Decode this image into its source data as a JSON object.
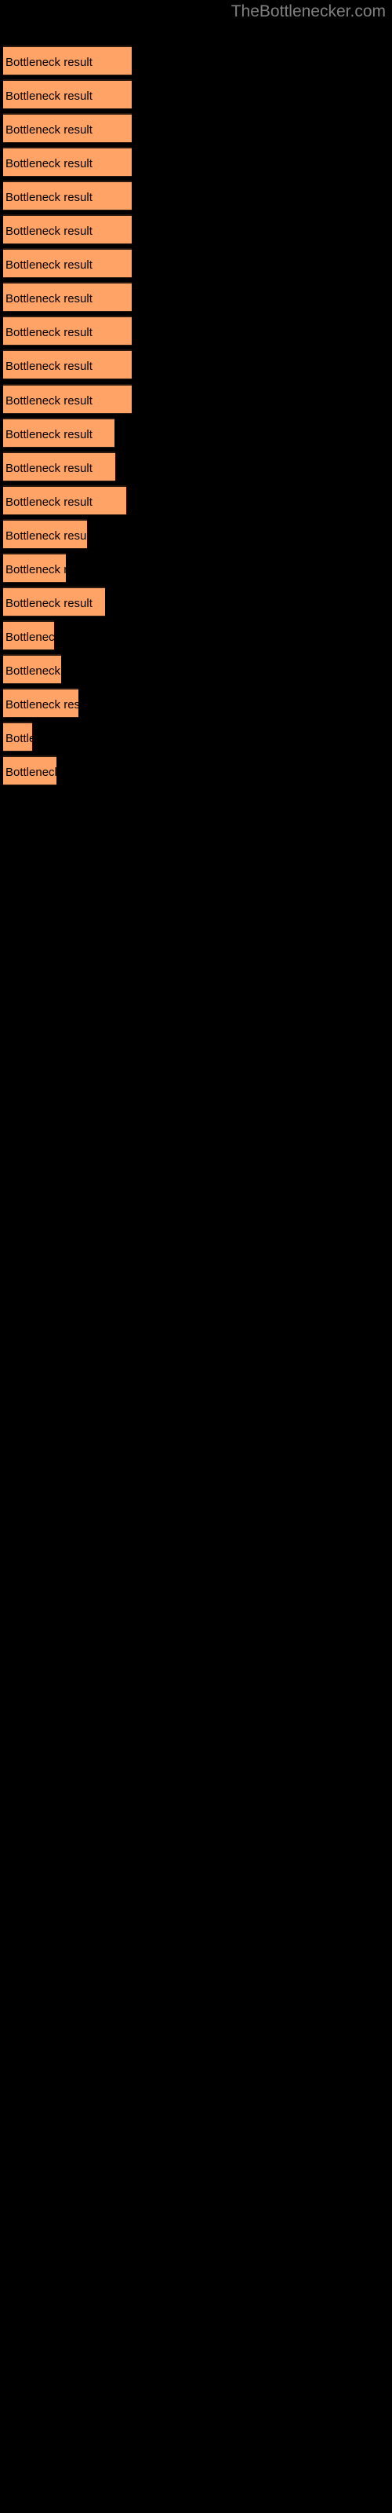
{
  "site": {
    "title": "TheBottlenecker.com",
    "title_color": "#808080"
  },
  "theme": {
    "background": "#000000",
    "bar_fill": "#FFA366",
    "bar_border": "#2b1a0f",
    "label_color": "#000000"
  },
  "chart_data": {
    "type": "bar",
    "orientation": "horizontal",
    "title": "",
    "subtitle": "",
    "xlabel": "",
    "ylabel": "",
    "grid": false,
    "legend": null,
    "axis_visible": false,
    "tick_labels": [],
    "bar_label_text": "Bottleneck result",
    "xlim": [
      0,
      500
    ],
    "categories": [
      "Bottleneck result",
      "Bottleneck result",
      "Bottleneck result",
      "Bottleneck result",
      "Bottleneck result",
      "Bottleneck result",
      "Bottleneck result",
      "Bottleneck result",
      "Bottleneck result",
      "Bottleneck result",
      "Bottleneck result",
      "Bottleneck result",
      "Bottleneck result",
      "Bottleneck result",
      "Bottleneck result",
      "Bottleneck result",
      "Bottleneck result",
      "Bottleneck result",
      "Bottleneck result",
      "Bottleneck result",
      "Bottleneck result",
      "Bottleneck result"
    ],
    "values": [
      164,
      164,
      164,
      164,
      164,
      164,
      164,
      164,
      164,
      164,
      164,
      142,
      143,
      157,
      107,
      80,
      130,
      65,
      74,
      96,
      37,
      68
    ],
    "bars": [
      {
        "index": 1,
        "label": "Bottleneck result",
        "y": 58,
        "width": 164,
        "value": 164
      },
      {
        "index": 2,
        "label": "Bottleneck result",
        "y": 101,
        "width": 164,
        "value": 164
      },
      {
        "index": 3,
        "label": "Bottleneck result",
        "y": 144,
        "width": 164,
        "value": 164
      },
      {
        "index": 4,
        "label": "Bottleneck result",
        "y": 187,
        "width": 164,
        "value": 164
      },
      {
        "index": 5,
        "label": "Bottleneck result",
        "y": 230,
        "width": 164,
        "value": 164
      },
      {
        "index": 6,
        "label": "Bottleneck result",
        "y": 273,
        "width": 164,
        "value": 164
      },
      {
        "index": 7,
        "label": "Bottleneck result",
        "y": 316,
        "width": 164,
        "value": 164
      },
      {
        "index": 8,
        "label": "Bottleneck result",
        "y": 359,
        "width": 164,
        "value": 164
      },
      {
        "index": 9,
        "label": "Bottleneck result",
        "y": 402,
        "width": 164,
        "value": 164
      },
      {
        "index": 10,
        "label": "Bottleneck result",
        "y": 445,
        "width": 164,
        "value": 164
      },
      {
        "index": 11,
        "label": "Bottleneck result",
        "y": 488,
        "width": 164,
        "value": 164
      },
      {
        "index": 12,
        "label": "Bottleneck result",
        "y": 531,
        "width": 142,
        "value": 142
      },
      {
        "index": 13,
        "label": "Bottleneck result",
        "y": 574,
        "width": 143,
        "value": 143
      },
      {
        "index": 14,
        "label": "Bottleneck result",
        "y": 617,
        "width": 157,
        "value": 157
      },
      {
        "index": 15,
        "label": "Bottleneck result",
        "y": 660,
        "width": 107,
        "value": 107
      },
      {
        "index": 16,
        "label": "Bottleneck result",
        "y": 703,
        "width": 80,
        "value": 80
      },
      {
        "index": 17,
        "label": "Bottleneck result",
        "y": 746,
        "width": 130,
        "value": 130
      },
      {
        "index": 18,
        "label": "Bottleneck result",
        "y": 789,
        "width": 65,
        "value": 65
      },
      {
        "index": 19,
        "label": "Bottleneck result",
        "y": 832,
        "width": 74,
        "value": 74
      },
      {
        "index": 20,
        "label": "Bottleneck result",
        "y": 875,
        "width": 96,
        "value": 96
      },
      {
        "index": 21,
        "label": "Bottleneck result",
        "y": 918,
        "width": 37,
        "value": 37
      },
      {
        "index": 22,
        "label": "Bottleneck result",
        "y": 961,
        "width": 68,
        "value": 68
      }
    ]
  }
}
